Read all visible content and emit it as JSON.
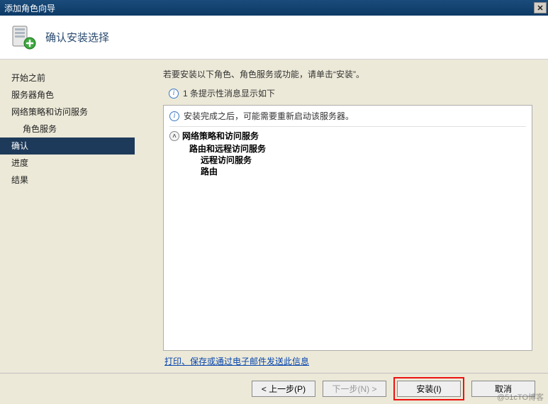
{
  "window": {
    "title": "添加角色向导"
  },
  "header": {
    "title": "确认安装选择"
  },
  "sidebar": {
    "items": [
      {
        "label": "开始之前",
        "indent": false
      },
      {
        "label": "服务器角色",
        "indent": false
      },
      {
        "label": "网络策略和访问服务",
        "indent": false
      },
      {
        "label": "角色服务",
        "indent": true
      },
      {
        "label": "确认",
        "indent": false,
        "selected": true
      },
      {
        "label": "进度",
        "indent": false
      },
      {
        "label": "结果",
        "indent": false
      }
    ]
  },
  "content": {
    "instruction": "若要安装以下角色、角色服务或功能，请单击“安装”。",
    "tip_line": "1 条提示性消息显示如下",
    "restart_notice": "安装完成之后，可能需要重新启动该服务器。",
    "group_title": "网络策略和访问服务",
    "tree": {
      "item1": "路由和远程访问服务",
      "item1a": "远程访问服务",
      "item1b": "路由"
    },
    "link": "打印、保存或通过电子邮件发送此信息"
  },
  "footer": {
    "prev": "< 上一步(P)",
    "next": "下一步(N) >",
    "install": "安装(I)",
    "cancel": "取消"
  },
  "watermark": "@51cTO博客"
}
